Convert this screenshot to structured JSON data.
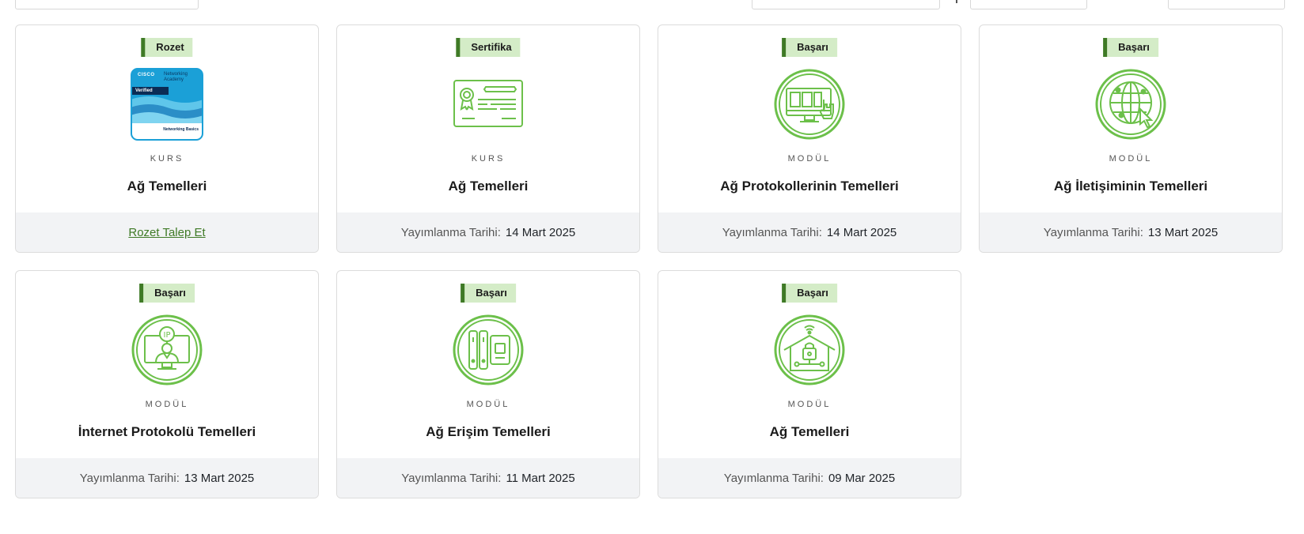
{
  "cards": [
    {
      "tag": "Rozet",
      "icon": "cisco-networking-basics-badge",
      "badge": {
        "brand": "CISCO",
        "academy": "Networking Academy",
        "verified": "Verified",
        "name": "Networking Basics"
      },
      "kind": "KURS",
      "title": "Ağ Temelleri",
      "footer_link": "Rozet Talep Et"
    },
    {
      "tag": "Sertifika",
      "icon": "certificate-icon",
      "kind": "KURS",
      "title": "Ağ Temelleri",
      "footer_label": "Yayımlanma Tarihi:",
      "footer_date": "14 Mart 2025"
    },
    {
      "tag": "Başarı",
      "icon": "monitor-touch-icon",
      "kind": "MODÜL",
      "title": "Ağ Protokollerinin Temelleri",
      "footer_label": "Yayımlanma Tarihi:",
      "footer_date": "14 Mart 2025"
    },
    {
      "tag": "Başarı",
      "icon": "globe-cursor-icon",
      "kind": "MODÜL",
      "title": "Ağ İletişiminin Temelleri",
      "footer_label": "Yayımlanma Tarihi:",
      "footer_date": "13 Mart 2025"
    },
    {
      "tag": "Başarı",
      "icon": "ip-person-monitor-icon",
      "kind": "MODÜL",
      "title": "İnternet Protokolü Temelleri",
      "footer_label": "Yayımlanma Tarihi:",
      "footer_date": "13 Mart 2025"
    },
    {
      "tag": "Başarı",
      "icon": "server-device-icon",
      "kind": "MODÜL",
      "title": "Ağ Erişim Temelleri",
      "footer_label": "Yayımlanma Tarihi:",
      "footer_date": "11 Mart 2025"
    },
    {
      "tag": "Başarı",
      "icon": "smart-home-lock-icon",
      "kind": "MODÜL",
      "title": "Ağ Temelleri",
      "footer_label": "Yayımlanma Tarihi:",
      "footer_date": "09 Mar 2025"
    }
  ],
  "colors": {
    "accent_green": "#3f7a26",
    "tag_bg": "#d4ecc7",
    "icon_green": "#6cc04a",
    "footer_bg": "#f2f3f5",
    "badge_blue": "#1ba0d7"
  }
}
